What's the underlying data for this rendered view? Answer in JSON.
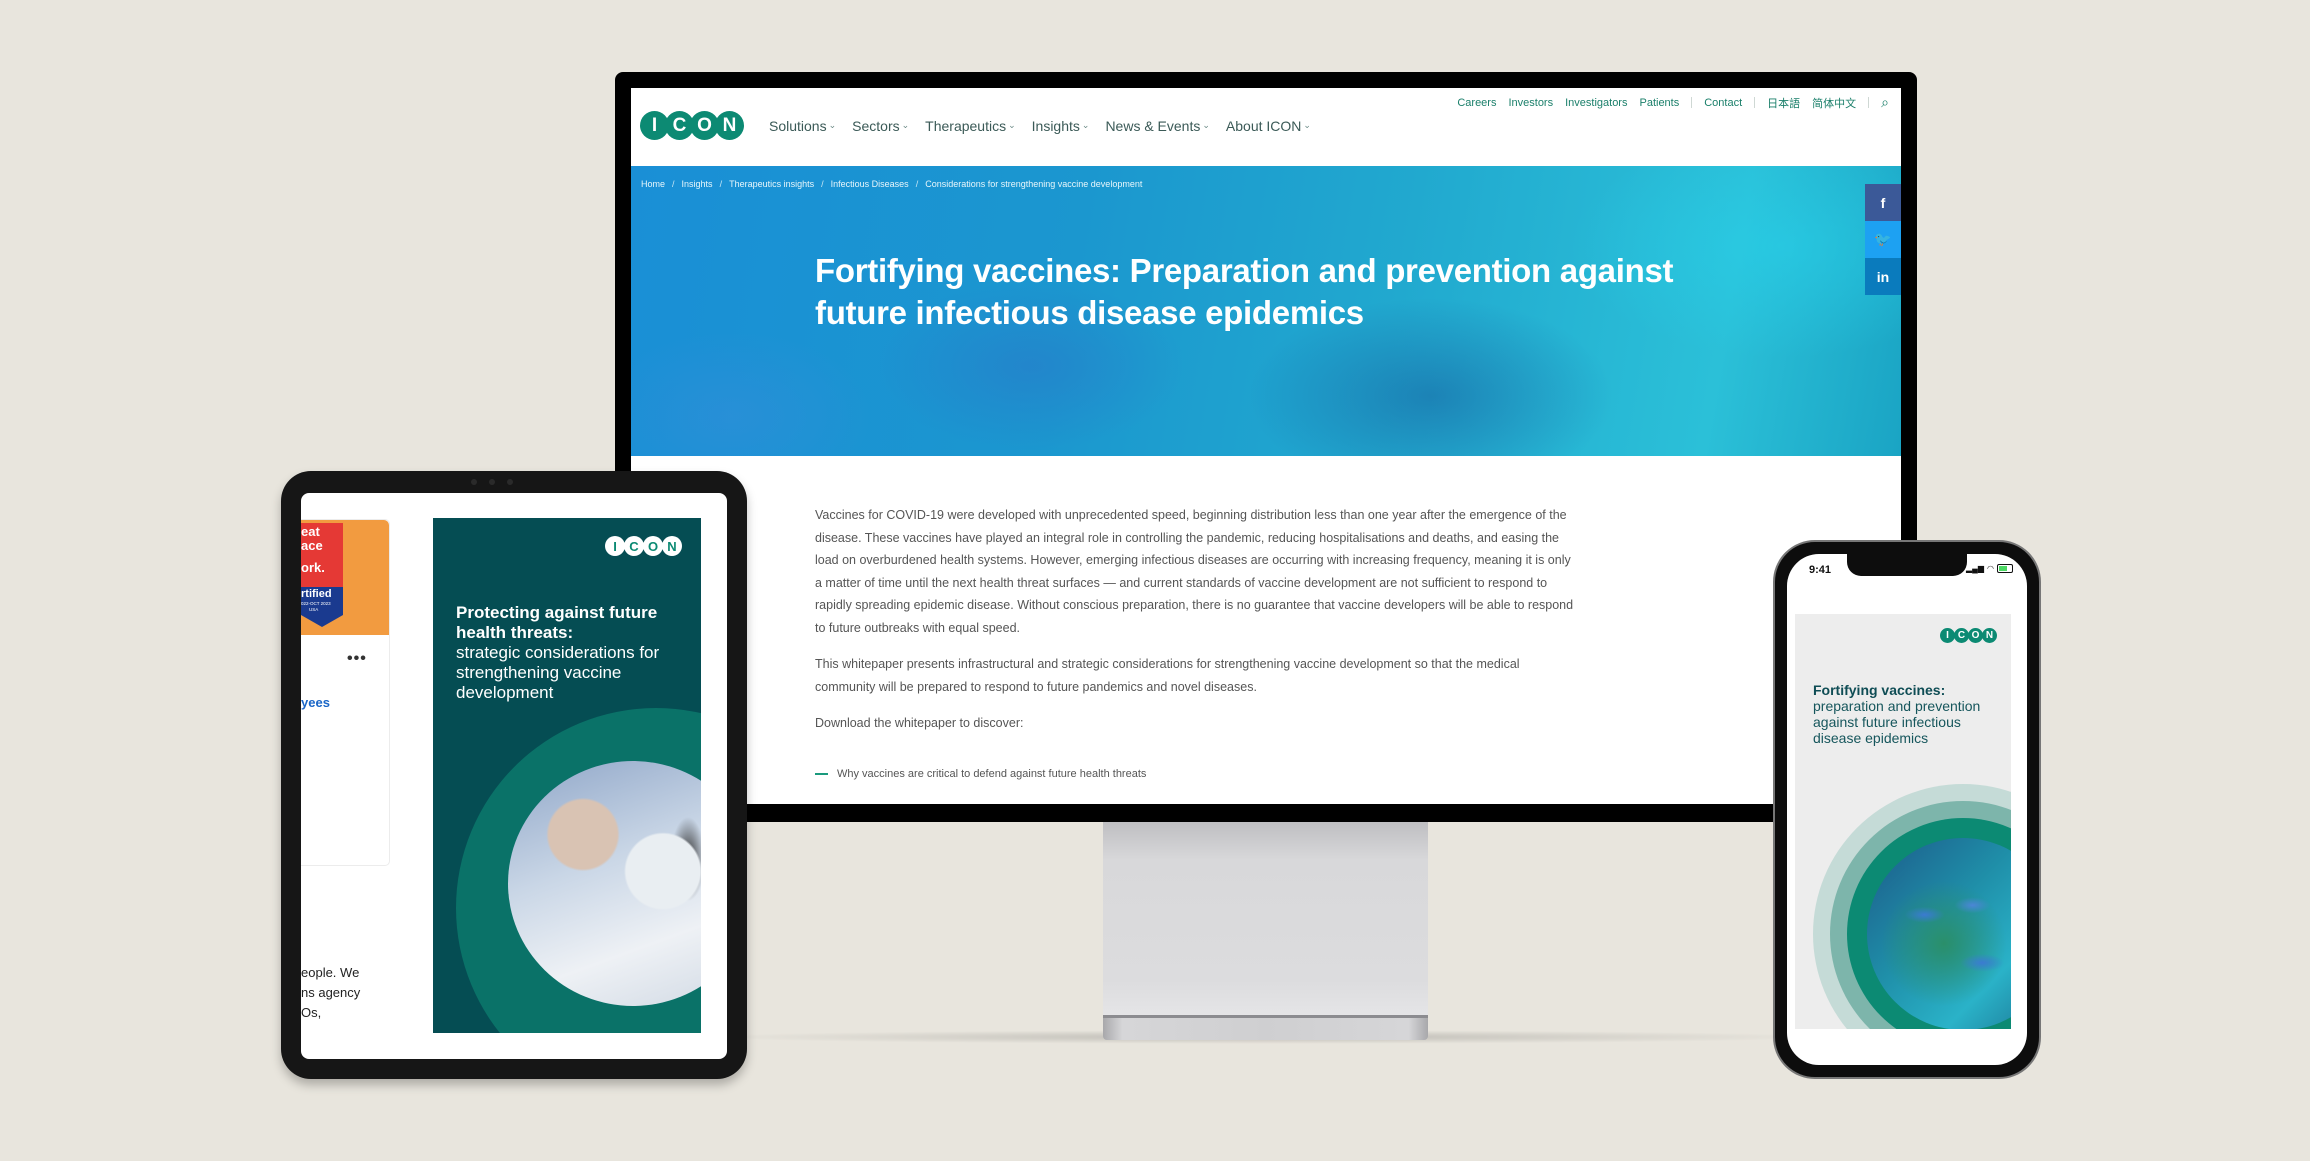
{
  "monitor": {
    "utility_nav": [
      "Careers",
      "Investors",
      "Investigators",
      "Patients",
      "Contact",
      "日本語",
      "简体中文"
    ],
    "logo_letters": [
      "I",
      "C",
      "O",
      "N"
    ],
    "main_nav": [
      "Solutions",
      "Sectors",
      "Therapeutics",
      "Insights",
      "News & Events",
      "About ICON"
    ],
    "search_icon": "search-icon",
    "breadcrumb": [
      "Home",
      "Insights",
      "Therapeutics insights",
      "Infectious Diseases",
      "Considerations for strengthening vaccine development"
    ],
    "hero_title": "Fortifying vaccines: Preparation and prevention against future infectious disease epidemics",
    "social": {
      "facebook": "f",
      "twitter": "🐦",
      "linkedin": "in"
    },
    "article": {
      "p1": "Vaccines for COVID-19 were developed with unprecedented speed, beginning distribution less than one year after the emergence of the disease. These vaccines have played an integral role in controlling the pandemic, reducing hospitalisations and deaths, and easing the load on overburdened health systems. However, emerging infectious diseases are occurring with increasing frequency, meaning it is only a matter of time until the next health threat surfaces — and current standards of vaccine development are not sufficient to respond to rapidly spreading epidemic disease. Without conscious preparation, there is no guarantee that vaccine developers will be able to respond to future outbreaks with equal speed.",
      "p2": "This whitepaper presents infrastructural and strategic considerations for strengthening vaccine development so that the medical community will be prepared to respond to future pandemics and novel diseases.",
      "p3": "Download the whitepaper to discover:",
      "bullet1": "Why vaccines are critical to defend against future health threats"
    }
  },
  "tablet": {
    "badge": {
      "line1": "eat",
      "line2": "ace",
      "line3": "ork.",
      "certified": "rtified",
      "dates": "022-OCT 2023",
      "country": "USA"
    },
    "more": "•••",
    "employees_link": "yees",
    "text_lines": [
      "eople. We",
      "ns agency",
      "Os,"
    ],
    "cover": {
      "logo_letters": [
        "I",
        "C",
        "O",
        "N"
      ],
      "title_bold": "Protecting against future health threats:",
      "title_rest": "strategic considerations for strengthening vaccine development"
    }
  },
  "phone": {
    "time": "9:41",
    "cover": {
      "logo_letters": [
        "I",
        "C",
        "O",
        "N"
      ],
      "title_bold": "Fortifying vaccines:",
      "title_rest": "preparation and prevention against future infectious disease epidemics"
    }
  },
  "colors": {
    "brand_green": "#0c8a73",
    "cover_teal": "#054d53",
    "background": "#e8e5dd"
  }
}
